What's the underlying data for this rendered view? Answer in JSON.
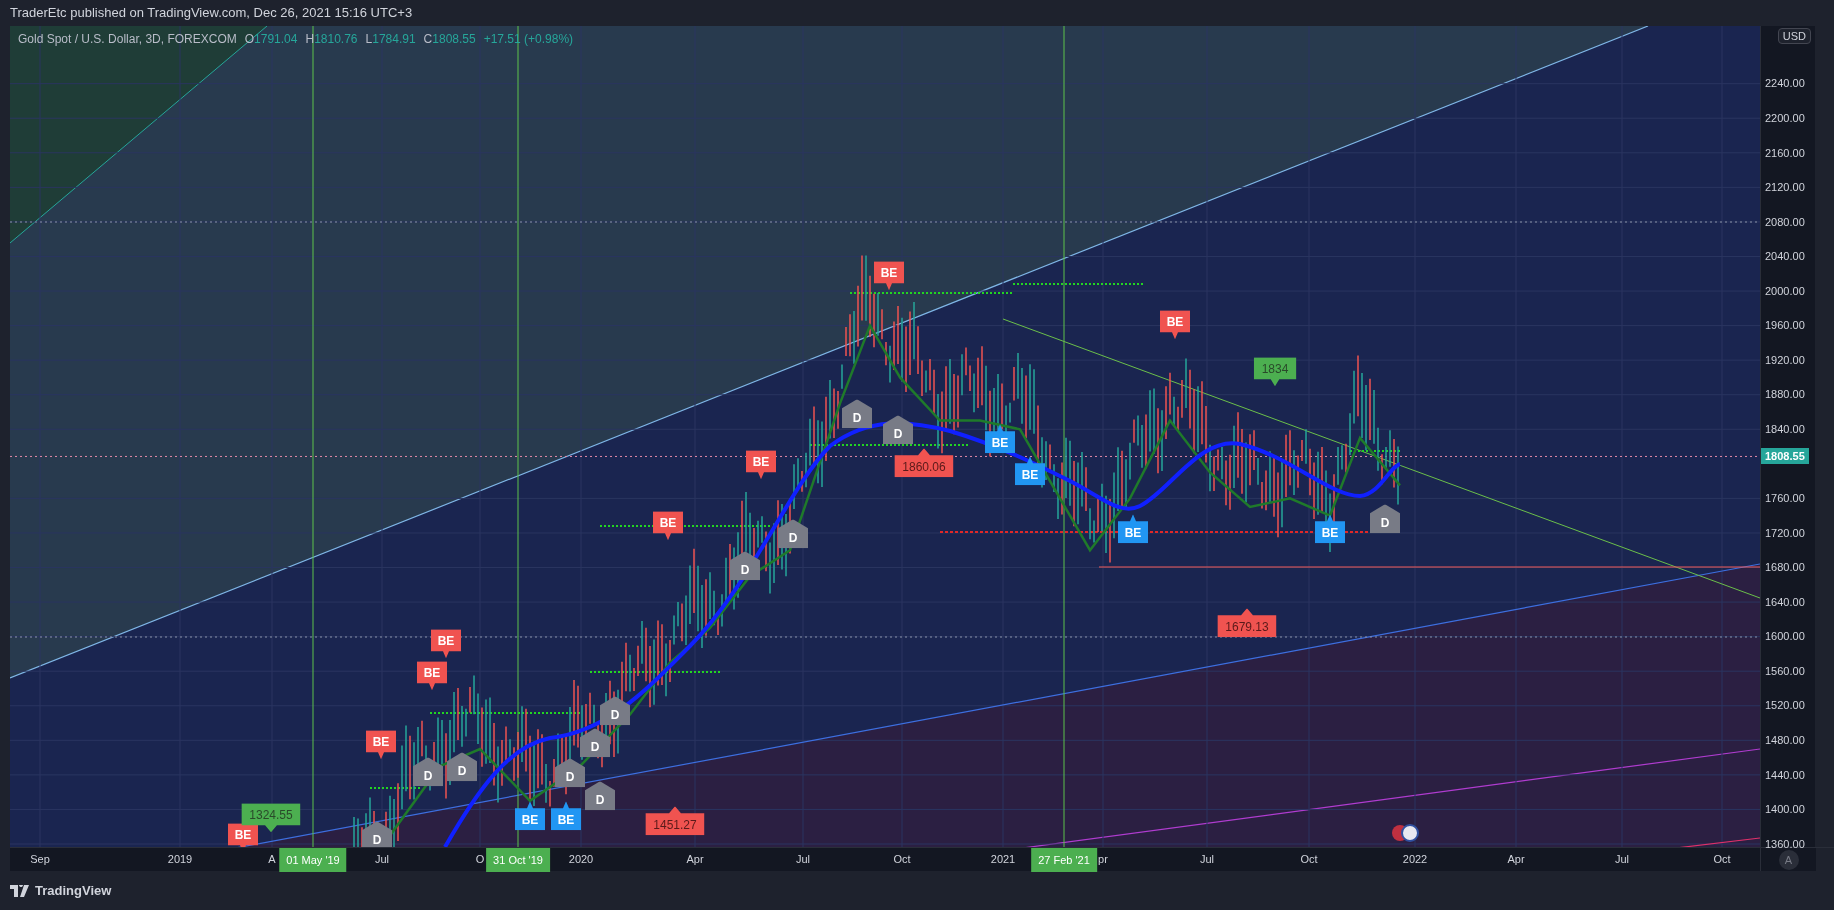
{
  "header": {
    "publisher_line": "TraderEtc published on TradingView.com, Dec 26, 2021 15:16 UTC+3"
  },
  "legend": {
    "symbol": "Gold Spot / U.S. Dollar, 3D, FOREXCOM",
    "ohlc": [
      {
        "label": "O",
        "value": "1791.04"
      },
      {
        "label": "H",
        "value": "1810.76"
      },
      {
        "label": "L",
        "value": "1784.91"
      },
      {
        "label": "C",
        "value": "1808.55"
      }
    ],
    "change": "+17.51 (+0.98%)"
  },
  "price_axis": {
    "currency": "USD",
    "ticks": [
      "2240.00",
      "2200.00",
      "2160.00",
      "2120.00",
      "2080.00",
      "2040.00",
      "2000.00",
      "1960.00",
      "1920.00",
      "1880.00",
      "1840.00",
      "1760.00",
      "1720.00",
      "1680.00",
      "1640.00",
      "1600.00",
      "1560.00",
      "1520.00",
      "1480.00",
      "1440.00",
      "1400.00",
      "1360.00"
    ],
    "last_price": "1808.55",
    "auto_scale": "A"
  },
  "time_axis": {
    "ticks": [
      "Sep",
      "2019",
      "A",
      "Jul",
      "O",
      "2020",
      "Apr",
      "Jul",
      "Oct",
      "2021",
      "pr",
      "Jul",
      "Oct",
      "2022",
      "Apr",
      "Jul",
      "Oct"
    ],
    "date_markers": [
      "01 May '19",
      "31 Oct '19",
      "27 Feb '21"
    ]
  },
  "markers": [
    {
      "kind": "sell",
      "text": "BE"
    },
    {
      "kind": "sell",
      "text": "BE"
    },
    {
      "kind": "sell",
      "text": "BE"
    },
    {
      "kind": "sell",
      "text": "BE"
    },
    {
      "kind": "sell",
      "text": "BE"
    },
    {
      "kind": "sell",
      "text": "BE"
    },
    {
      "kind": "sell",
      "text": "BE"
    },
    {
      "kind": "sell",
      "text": "BE"
    },
    {
      "kind": "divergence",
      "text": "D"
    },
    {
      "kind": "divergence",
      "text": "D"
    },
    {
      "kind": "divergence",
      "text": "D"
    },
    {
      "kind": "divergence",
      "text": "D"
    },
    {
      "kind": "divergence",
      "text": "D"
    },
    {
      "kind": "divergence",
      "text": "D"
    },
    {
      "kind": "divergence",
      "text": "D"
    },
    {
      "kind": "divergence",
      "text": "D"
    },
    {
      "kind": "divergence",
      "text": "D"
    },
    {
      "kind": "divergence",
      "text": "D"
    },
    {
      "kind": "divergence",
      "text": "D"
    },
    {
      "kind": "divergence",
      "text": "D"
    },
    {
      "kind": "buy",
      "text": "BE"
    },
    {
      "kind": "buy",
      "text": "BE"
    },
    {
      "kind": "buy",
      "text": "BE"
    },
    {
      "kind": "buy",
      "text": "BE"
    },
    {
      "kind": "buy",
      "text": "BE"
    },
    {
      "kind": "buy",
      "text": "BE"
    }
  ],
  "price_labels": [
    {
      "kind": "high",
      "text": "1324.55"
    },
    {
      "kind": "low",
      "text": "1860.06"
    },
    {
      "kind": "high",
      "text": "1834"
    },
    {
      "kind": "low",
      "text": "1679.13"
    },
    {
      "kind": "low",
      "text": "1451.27"
    }
  ],
  "footer": {
    "brand": "TradingView"
  }
}
